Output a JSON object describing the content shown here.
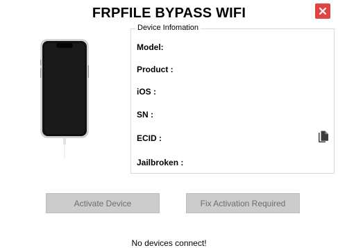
{
  "window": {
    "title": "FRPFILE BYPASS WIFI"
  },
  "device_info": {
    "legend": "Device Infomation",
    "fields": {
      "model": "Model:",
      "product": "Product :",
      "ios": "iOS :",
      "sn": "SN :",
      "ecid": "ECID :",
      "jailbroken": "Jailbroken :"
    }
  },
  "buttons": {
    "activate": "Activate Device",
    "fix": "Fix Activation Required"
  },
  "status": {
    "message": "No devices connect!"
  },
  "colors": {
    "close_button": "#e04343",
    "disabled_button": "#cccccc",
    "disabled_text": "#6d6d6d"
  },
  "icons": {
    "close": "close-icon",
    "copy": "copy-icon",
    "device": "iphone-icon"
  }
}
